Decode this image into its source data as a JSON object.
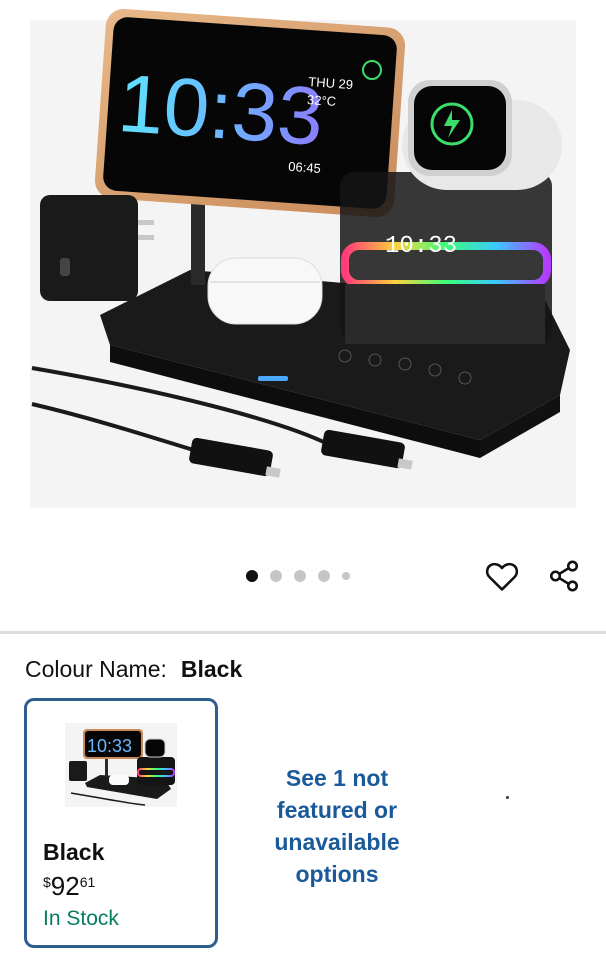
{
  "product_image": {
    "phone_time": "10:33",
    "phone_date": "THU 29",
    "phone_temp": "32°C",
    "phone_alarm": "06:45",
    "display_time": "10:33"
  },
  "carousel": {
    "dot_count": 5,
    "active_index": 0
  },
  "actions": {
    "wishlist_icon": "heart-icon",
    "share_icon": "share-icon"
  },
  "colour": {
    "label": "Colour Name:",
    "value": "Black"
  },
  "variant": {
    "thumb_time": "10:33",
    "name": "Black",
    "price_symbol": "$",
    "price_whole": "92",
    "price_fraction": "61",
    "stock": "In Stock"
  },
  "see_more": "See 1 not featured or unavailable options",
  "colors": {
    "selected_border": "#2e5e8e",
    "link": "#1b5a9a",
    "in_stock": "#067d62"
  }
}
